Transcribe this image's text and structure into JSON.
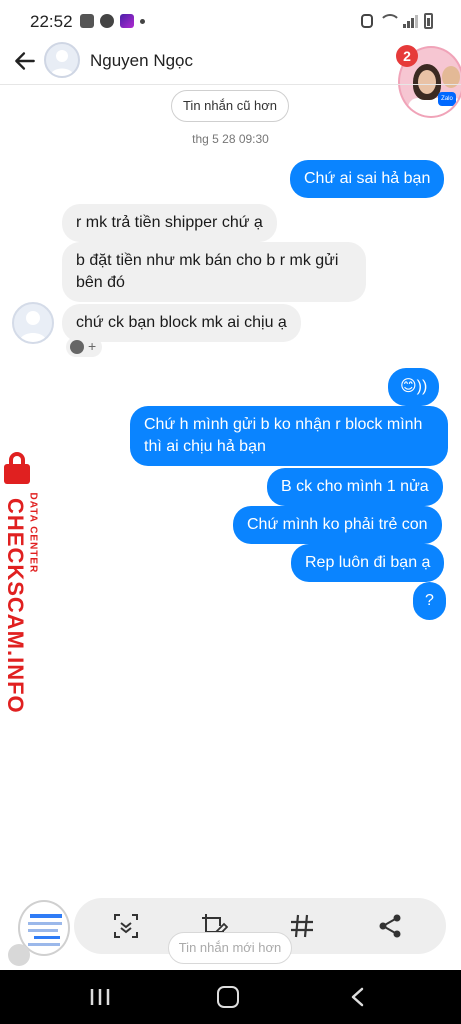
{
  "status_bar": {
    "time": "22:52",
    "left_icons": [
      "gallery-icon",
      "messenger-icon",
      "game-icon",
      "dot-icon"
    ],
    "right_icons": [
      "alarm-icon",
      "wifi-icon",
      "signal-icon",
      "battery-icon"
    ]
  },
  "header": {
    "contact_name": "Nguyen Ngọc",
    "back_icon": "arrow-left-icon"
  },
  "chat_head": {
    "badge_count": "2",
    "app_icon": "zalo-icon",
    "app_label": "Zalo"
  },
  "thread": {
    "older_button": "Tin nhắn cũ hơn",
    "timestamp": "thg 5 28 09:30",
    "messages": [
      {
        "side": "out",
        "text": "Chứ ai sai hả bạn"
      },
      {
        "side": "in",
        "text": "r mk trả tiền shipper chứ ạ"
      },
      {
        "side": "in",
        "text": "b đặt tiền như mk bán cho b r mk gửi bên đó"
      },
      {
        "side": "in",
        "text": "chứ ck bạn block mk ai chịu ạ"
      },
      {
        "side": "out",
        "text": "😊))"
      },
      {
        "side": "out",
        "text": "Chứ h mình gửi b ko nhận r block mình thì ai chịu hả bạn"
      },
      {
        "side": "out",
        "text": "B ck cho mình 1 nửa"
      },
      {
        "side": "out",
        "text": "Chứ mình ko phải trẻ con"
      },
      {
        "side": "out",
        "text": "Rep luôn đi bạn ạ"
      },
      {
        "side": "out",
        "text": "?"
      }
    ],
    "reaction_icons": [
      "smile-icon",
      "plus-icon"
    ]
  },
  "watermark": {
    "main": "CHECKSCAM.INFO",
    "sub": "DATA CENTER"
  },
  "screenshot_toolbar": {
    "buttons": [
      "scroll-capture-icon",
      "crop-edit-icon",
      "hashtag-icon",
      "share-icon"
    ]
  },
  "newer_button": "Tin nhắn mới hơn",
  "nav_bar": {
    "buttons": [
      "recent-apps-icon",
      "home-icon",
      "back-icon"
    ]
  },
  "colors": {
    "outgoing_bubble": "#0a84ff",
    "incoming_bubble": "#f0f0f0",
    "watermark_red": "#e02020",
    "badge_red": "#e63a3a"
  }
}
